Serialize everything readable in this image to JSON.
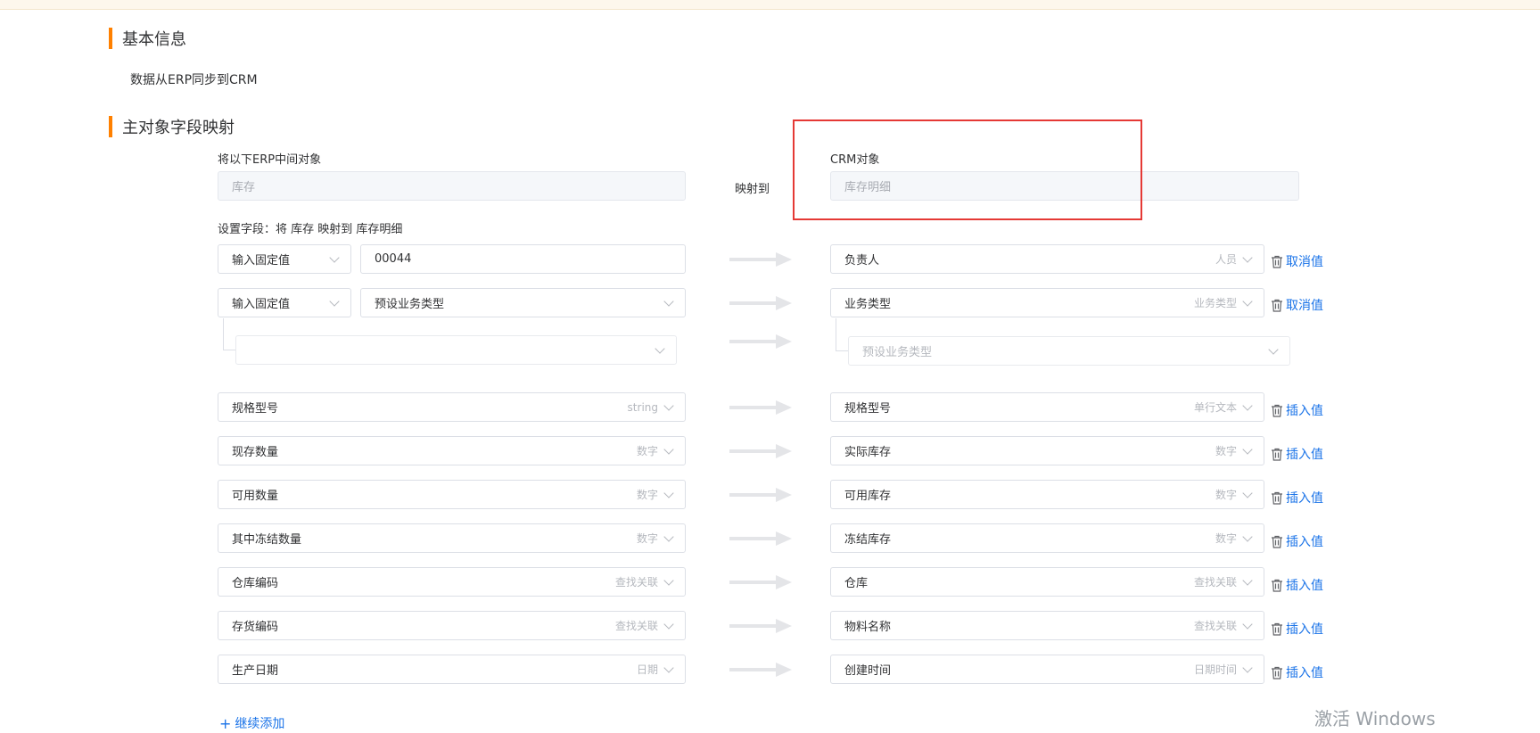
{
  "sections": {
    "basic_title": "基本信息",
    "basic_desc": "数据从ERP同步到CRM",
    "mapping_title": "主对象字段映射"
  },
  "source": {
    "label": "将以下ERP中间对象",
    "value": "库存"
  },
  "map_to": "映射到",
  "target": {
    "label": "CRM对象",
    "value": "库存明细"
  },
  "fields_label": "设置字段：将 库存 映射到 库存明细",
  "rows": [
    {
      "left_select": "输入固定值",
      "left_value": "00044",
      "right_field": "负责人",
      "right_type": "人员",
      "action": "取消值"
    },
    {
      "left_select": "输入固定值",
      "left_value": "预设业务类型",
      "right_field": "业务类型",
      "right_type": "业务类型",
      "action": "取消值"
    },
    {
      "sub_left": "",
      "sub_right": "预设业务类型"
    },
    {
      "left_field": "规格型号",
      "left_type": "string",
      "right_field": "规格型号",
      "right_type": "单行文本",
      "action": "插入值"
    },
    {
      "left_field": "现存数量",
      "left_type": "数字",
      "right_field": "实际库存",
      "right_type": "数字",
      "action": "插入值"
    },
    {
      "left_field": "可用数量",
      "left_type": "数字",
      "right_field": "可用库存",
      "right_type": "数字",
      "action": "插入值"
    },
    {
      "left_field": "其中冻结数量",
      "left_type": "数字",
      "right_field": "冻结库存",
      "right_type": "数字",
      "action": "插入值"
    },
    {
      "left_field": "仓库编码",
      "left_type": "查找关联",
      "right_field": "仓库",
      "right_type": "查找关联",
      "action": "插入值"
    },
    {
      "left_field": "存货编码",
      "left_type": "查找关联",
      "right_field": "物料名称",
      "right_type": "查找关联",
      "action": "插入值"
    },
    {
      "left_field": "生产日期",
      "left_type": "日期",
      "right_field": "创建时间",
      "right_type": "日期时间",
      "action": "插入值"
    }
  ],
  "add_more": "继续添加",
  "watermark": "激活 Windows",
  "colors": {
    "accent": "#ff8000",
    "link": "#1a73e8",
    "highlight": "#e53935"
  }
}
